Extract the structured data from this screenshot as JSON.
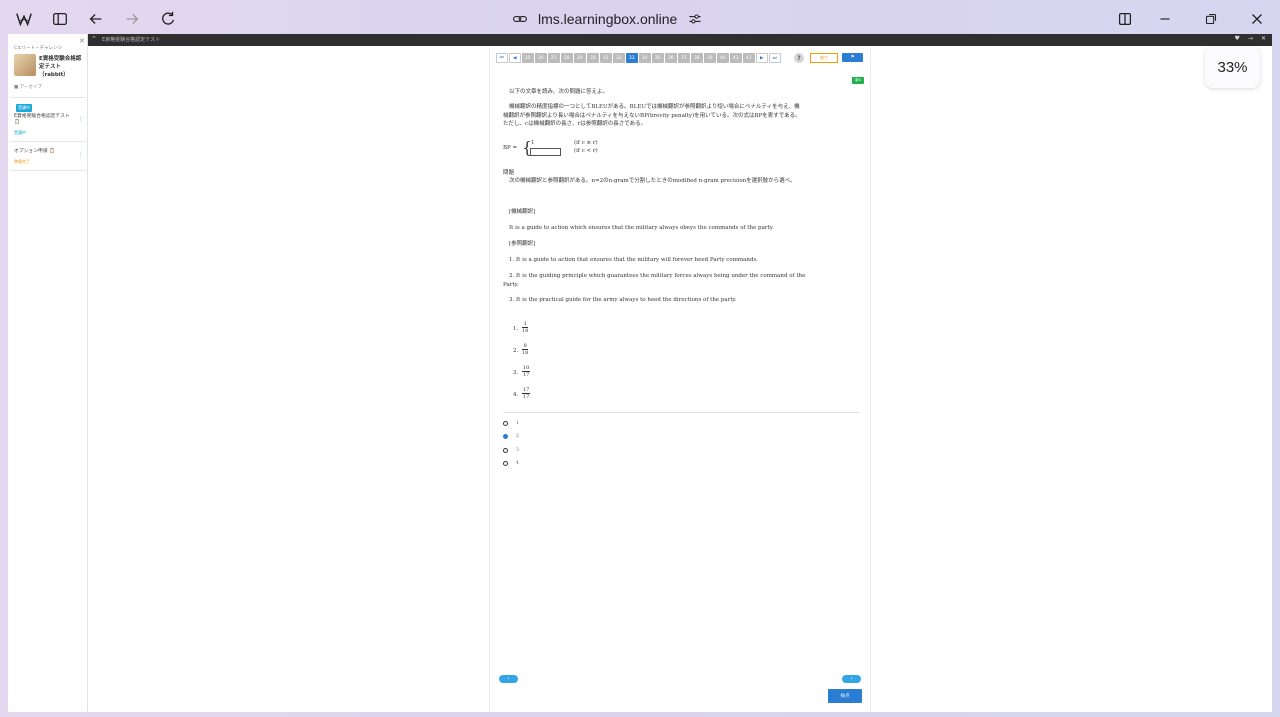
{
  "browser": {
    "url": "lms.learningbox.online",
    "zoom": "33%"
  },
  "darkbar": {
    "crumb": "E資格受験合格認定テスト"
  },
  "sidebar": {
    "top_label": "Cエリート・チャレンジ",
    "course_title": "E資格受験合格認定テスト（rabbit）",
    "meta": "■ アーカイブ",
    "badge": "受講中",
    "items": [
      {
        "label": "E資格受験合格認定テスト 📋",
        "status": "受講中"
      },
      {
        "label": "オプション申請 📋",
        "status": "準備完了"
      }
    ]
  },
  "exam": {
    "nav": {
      "first": "⏮",
      "prev": "◀",
      "pages": [
        "25",
        "26",
        "27",
        "28",
        "29",
        "30",
        "31",
        "32",
        "33",
        "34",
        "35",
        "36",
        "37",
        "38",
        "39",
        "40",
        "41",
        "42"
      ],
      "active_page": "33",
      "next": "▶",
      "last": "⏭"
    },
    "help_label": "?",
    "later_label": "後で",
    "flag_label": "⚑",
    "question_badge": "新4",
    "intro": "以下の文章を読み、次の問題に答えよ。",
    "paragraph": "機械翻訳の精度指標の一つとしてBLEUがある。BLEUでは機械翻訳が参照翻訳より短い場合にペナルティを与え、機械翻訳が参照翻訳より長い場合はペナルティを与えないBP(brevity penalty)を用いている。次の式はBPを表すである。ただし、cは機械翻訳の長さ、rは参照翻訳の長さである。",
    "formula": {
      "lhs": "BP =",
      "case1_value": "1",
      "case1_cond": "(if   c ≥ r)",
      "case2_cond": "(if   c < r)"
    },
    "problem_label": "問題",
    "problem_text": "次の機械翻訳と参照翻訳がある。n=2のn-gramで分割したときのmodified n-gram precisionを選択肢から選べ。",
    "mt_label": "[機械翻訳]",
    "mt_text": "It is a guide to action which ensures that the military always obeys the commands of the party.",
    "ref_label": "[参照翻訳]",
    "refs": [
      "1. It is a guide to action that ensures that the military will forever heed Party commands.",
      "2. It is the guiding principle which guarantees the military forces always being under the command of the Party.",
      "3. It is the practical guide for the army always to heed the directions of the party."
    ],
    "options": [
      {
        "num": "1.",
        "numerator": "1",
        "denominator": "18"
      },
      {
        "num": "2.",
        "numerator": "8",
        "denominator": "18"
      },
      {
        "num": "3.",
        "numerator": "10",
        "denominator": "17"
      },
      {
        "num": "4.",
        "numerator": "17",
        "denominator": "17"
      }
    ],
    "choices": [
      {
        "label": "1",
        "checked": false
      },
      {
        "label": "2",
        "checked": true
      },
      {
        "label": "3",
        "checked": false
      },
      {
        "label": "4",
        "checked": false
      }
    ],
    "prev_label": "‹",
    "next_label": "›",
    "submit_label": "採点"
  }
}
